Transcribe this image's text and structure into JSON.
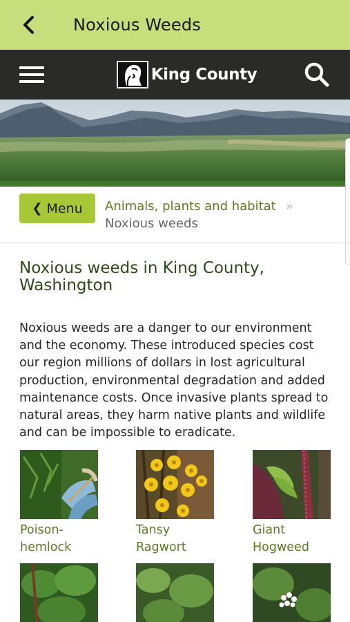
{
  "appbar": {
    "title": "Noxious Weeds",
    "back_icon": "chevron-left-icon"
  },
  "site_header": {
    "logo_text": "King County",
    "menu_icon": "hamburger-icon",
    "search_icon": "search-icon"
  },
  "breadcrumb": {
    "menu_button_label": "Menu",
    "parent": "Animals, plants and habitat",
    "separator": "»",
    "current": "Noxious weeds"
  },
  "page": {
    "heading": "Noxious weeds in King County, Washington",
    "intro": "Noxious weeds are a danger to our environment and the economy. These introduced species cost our region millions of dollars in lost agricultural production, environmental degradation and added maintenance costs.  Once invasive plants spread to natural areas, they harm native plants and wildlife and can be impossible to eradicate."
  },
  "weeds": [
    {
      "line1": "Poison-",
      "line2": "hemlock"
    },
    {
      "line1": "Tansy",
      "line2": "Ragwort"
    },
    {
      "line1": "Giant",
      "line2": "Hogweed"
    },
    {
      "line1": "",
      "line2": ""
    },
    {
      "line1": "",
      "line2": ""
    },
    {
      "line1": "",
      "line2": ""
    }
  ],
  "colors": {
    "appbar": "#c8dd7c",
    "header": "#2a2a28",
    "accent": "#a7c736",
    "link": "#5b7a23"
  }
}
